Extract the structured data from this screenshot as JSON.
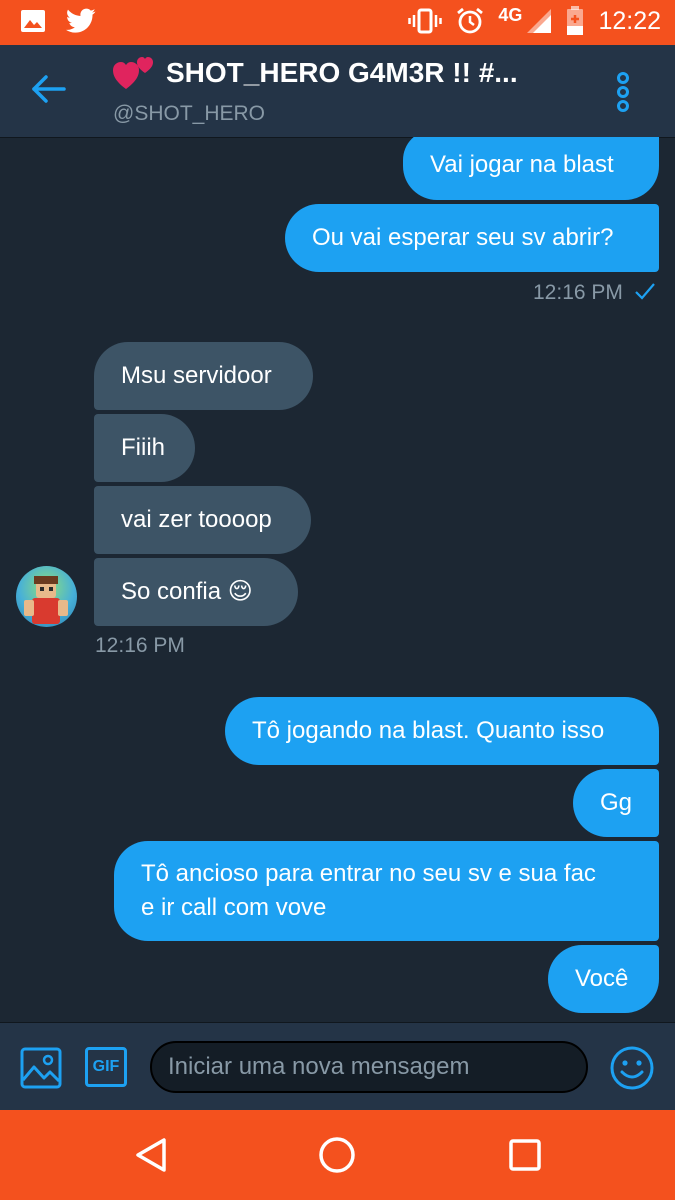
{
  "status_bar": {
    "time": "12:22",
    "network": "4G",
    "left_icons": [
      "gallery-icon",
      "twitter-icon"
    ],
    "right_icons": [
      "vibrate-icon",
      "alarm-icon",
      "signal-icon",
      "battery-icon"
    ]
  },
  "header": {
    "title": "SHOT_HERO G4M3R !! #...",
    "handle": "@SHOT_HERO",
    "back_icon": "back-arrow-icon",
    "menu_icon": "more-vertical-icon"
  },
  "messages": [
    {
      "direction": "out",
      "text": "Vai jogar na blast"
    },
    {
      "direction": "out",
      "text": "Ou vai esperar seu sv abrir?"
    },
    {
      "direction": "in",
      "text": "Msu servidoor"
    },
    {
      "direction": "in",
      "text": "Fiiih"
    },
    {
      "direction": "in",
      "text": "vai zer toooop"
    },
    {
      "direction": "in",
      "text": "So confia 😌"
    },
    {
      "direction": "out",
      "text": "Tô jogando na blast. Quanto isso"
    },
    {
      "direction": "out",
      "text": "Gg"
    },
    {
      "direction": "out",
      "text_line1": "Tô ancioso para entrar no seu sv e sua fac",
      "text_line2": "e ir call com vove"
    },
    {
      "direction": "out",
      "text": "Você"
    }
  ],
  "timestamps": {
    "outgoing_1": "12:16 PM",
    "incoming_1": "12:16 PM"
  },
  "composer": {
    "placeholder": "Iniciar uma nova mensagem",
    "gif_label": "GIF"
  },
  "colors": {
    "accent": "#1da1f2",
    "system_bar": "#f4511e",
    "background": "#1c2733",
    "header": "#243447",
    "incoming_bubble": "#3d5466",
    "muted_text": "#8899a6"
  }
}
